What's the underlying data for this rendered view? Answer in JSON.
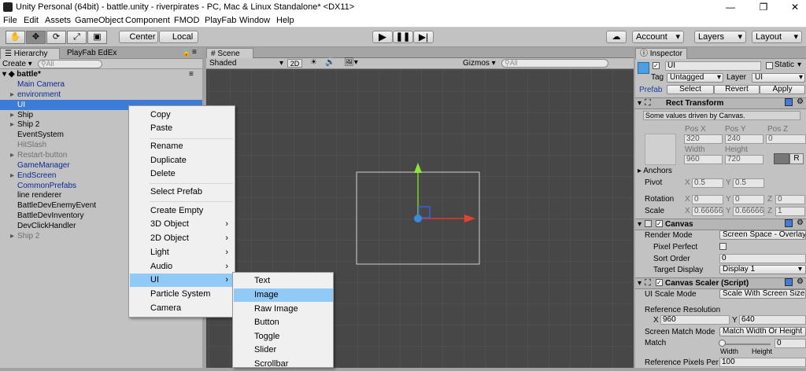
{
  "window": {
    "title": "Unity Personal (64bit) - battle.unity - riverpirates - PC, Mac & Linux Standalone* <DX11>",
    "minimize": "—",
    "maximize": "❐",
    "close": "✕"
  },
  "menubar": [
    "File",
    "Edit",
    "Assets",
    "GameObject",
    "Component",
    "FMOD",
    "PlayFab",
    "Window",
    "Help"
  ],
  "toolbar": {
    "center": "Center",
    "local": "Local",
    "account": "Account",
    "layers": "Layers",
    "layout": "Layout"
  },
  "hierarchy": {
    "tab": "Hierarchy",
    "tab2": "PlayFab EdEx",
    "create": "Create",
    "search_placeholder": "All",
    "scene": "battle*",
    "items": [
      {
        "label": "Main Camera",
        "style": "blue"
      },
      {
        "label": "environment",
        "style": "blue"
      },
      {
        "label": "UI",
        "style": "selected"
      },
      {
        "label": "Ship",
        "style": "normal"
      },
      {
        "label": "Ship 2",
        "style": "normal"
      },
      {
        "label": "EventSystem",
        "style": "normal"
      },
      {
        "label": "HitSlash",
        "style": "gray"
      },
      {
        "label": "Restart-button",
        "style": "gray"
      },
      {
        "label": "GameManager",
        "style": "blue"
      },
      {
        "label": "EndScreen",
        "style": "blue"
      },
      {
        "label": "CommonPrefabs",
        "style": "blue"
      },
      {
        "label": "line renderer",
        "style": "normal"
      },
      {
        "label": "BattleDevEnemyEvent",
        "style": "normal"
      },
      {
        "label": "BattleDevInventory",
        "style": "normal"
      },
      {
        "label": "DevClickHandler",
        "style": "normal"
      },
      {
        "label": "Ship 2",
        "style": "gray"
      }
    ]
  },
  "scene": {
    "tab": "Scene",
    "shading": "Shaded",
    "mode2d": "2D",
    "gizmos": "Gizmos",
    "search_placeholder": "All"
  },
  "context_menu": {
    "items": [
      "Copy",
      "Paste",
      "Rename",
      "Duplicate",
      "Delete",
      "Select Prefab",
      "Create Empty",
      "3D Object",
      "2D Object",
      "Light",
      "Audio",
      "UI",
      "Particle System",
      "Camera"
    ],
    "highlighted": "UI",
    "submenu": [
      "Text",
      "Image",
      "Raw Image",
      "Button",
      "Toggle",
      "Slider",
      "Scrollbar"
    ],
    "submenu_highlighted": "Image"
  },
  "inspector": {
    "tab": "Inspector",
    "name": "UI",
    "static": "Static",
    "tag_label": "Tag",
    "tag": "Untagged",
    "layer_label": "Layer",
    "layer": "UI",
    "prefab": "Prefab",
    "select": "Select",
    "revert": "Revert",
    "apply": "Apply",
    "rect_transform": "Rect Transform",
    "driven": "Some values driven by Canvas.",
    "posx_l": "Pos X",
    "posy_l": "Pos Y",
    "posz_l": "Pos Z",
    "posx": "320",
    "posy": "240",
    "posz": "0",
    "width_l": "Width",
    "height_l": "Height",
    "width": "960",
    "height": "720",
    "r": "R",
    "anchors": "Anchors",
    "pivot": "Pivot",
    "pivot_x": "0.5",
    "pivot_y": "0.5",
    "rotation": "Rotation",
    "rot_x": "0",
    "rot_y": "0",
    "rot_z": "0",
    "scale": "Scale",
    "scale_x": "0.66666",
    "scale_y": "0.66666",
    "scale_z": "1",
    "x": "X",
    "y": "Y",
    "z": "Z",
    "canvas": "Canvas",
    "render_mode_l": "Render Mode",
    "render_mode": "Screen Space - Overlay",
    "pixel_perfect": "Pixel Perfect",
    "sort_order_l": "Sort Order",
    "sort_order": "0",
    "target_display_l": "Target Display",
    "target_display": "Display 1",
    "canvas_scaler": "Canvas Scaler (Script)",
    "ui_scale_mode_l": "UI Scale Mode",
    "ui_scale_mode": "Scale With Screen Size",
    "ref_res": "Reference Resolution",
    "ref_x": "960",
    "ref_y": "640",
    "match_mode_l": "Screen Match Mode",
    "match_mode": "Match Width Or Height",
    "match_l": "Match",
    "match": "0",
    "width_w": "Width",
    "height_w": "Height",
    "ref_ppu_l": "Reference Pixels Per",
    "ref_ppu": "100"
  }
}
